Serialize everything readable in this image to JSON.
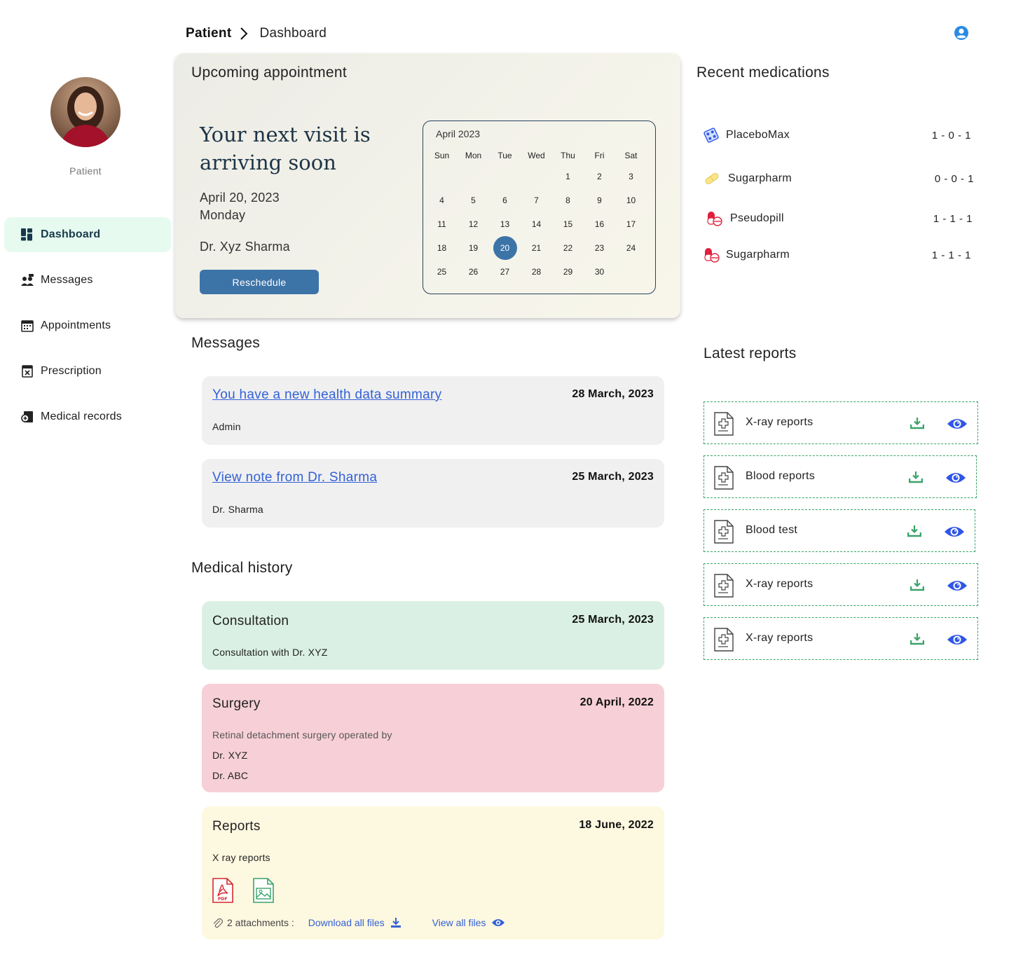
{
  "breadcrumb": {
    "root": "Patient",
    "current": "Dashboard"
  },
  "sidebar": {
    "role": "Patient",
    "items": [
      {
        "label": "Dashboard",
        "icon": "dashboard-icon",
        "active": true
      },
      {
        "label": "Messages",
        "icon": "messages-icon"
      },
      {
        "label": "Appointments",
        "icon": "appointments-icon"
      },
      {
        "label": "Prescription",
        "icon": "prescription-icon"
      },
      {
        "label": "Medical records",
        "icon": "medical-records-icon"
      }
    ]
  },
  "appointment": {
    "title": "Upcoming appointment",
    "headline_1": "Your next visit is",
    "headline_2": "arriving soon",
    "date": "April 20, 2023",
    "weekday": "Monday",
    "doctor": "Dr. Xyz Sharma",
    "reschedule_label": "Reschedule",
    "calendar": {
      "month": "April 2023",
      "weekdays": [
        "Sun",
        "Mon",
        "Tue",
        "Wed",
        "Thu",
        "Fri",
        "Sat"
      ],
      "days": [
        "",
        "",
        "",
        "",
        "1",
        "2",
        "3",
        "4",
        "5",
        "6",
        "7",
        "8",
        "9",
        "10",
        "11",
        "12",
        "13",
        "14",
        "15",
        "16",
        "17",
        "18",
        "19",
        "20",
        "21",
        "22",
        "23",
        "24",
        "25",
        "26",
        "27",
        "28",
        "29",
        "30",
        ""
      ],
      "selected": "20"
    }
  },
  "messages": {
    "title": "Messages",
    "items": [
      {
        "subject": "You have a new health data summary",
        "date": "28 March, 2023",
        "from": "Admin"
      },
      {
        "subject": "View note from Dr. Sharma",
        "date": "25 March, 2023",
        "from": "Dr. Sharma"
      }
    ]
  },
  "history": {
    "title": "Medical history",
    "consultation": {
      "title": "Consultation",
      "date": "25 March, 2023",
      "text": "Consultation with Dr. XYZ"
    },
    "surgery": {
      "title": "Surgery",
      "date": "20 April, 2022",
      "text": "Retinal detachment surgery operated by",
      "doctors": [
        "Dr. XYZ",
        "Dr. ABC"
      ]
    },
    "reports": {
      "title": "Reports",
      "date": "18 June, 2022",
      "text": "X ray reports",
      "attachments_label": "2 attachments :",
      "download_all": "Download all files",
      "view_all": "View all files"
    }
  },
  "medications": {
    "title": "Recent medications",
    "items": [
      {
        "name": "PlaceboMax",
        "dose": "1 - 0 - 1",
        "icon": "pill-blister-icon"
      },
      {
        "name": "Sugarpharm",
        "dose": "0 - 0 - 1",
        "icon": "pill-icon"
      },
      {
        "name": "Pseudopill",
        "dose": "1 - 1 - 1",
        "icon": "capsule-icon"
      },
      {
        "name": "Sugarpharm",
        "dose": "1 - 1 - 1",
        "icon": "capsule-icon"
      }
    ]
  },
  "reports": {
    "title": "Latest reports",
    "items": [
      {
        "name": "X-ray reports"
      },
      {
        "name": "Blood reports"
      },
      {
        "name": "Blood test"
      },
      {
        "name": "X-ray reports"
      },
      {
        "name": "X-ray reports"
      }
    ]
  },
  "colors": {
    "accent": "#3d74a8",
    "link": "#3361d6",
    "active_nav": "#e6faf0",
    "consultation": "#daf0e4",
    "surgery": "#f7d0d7",
    "reports": "#fdf8e0",
    "download": "#3aa36a",
    "eye": "#2f56e6"
  }
}
